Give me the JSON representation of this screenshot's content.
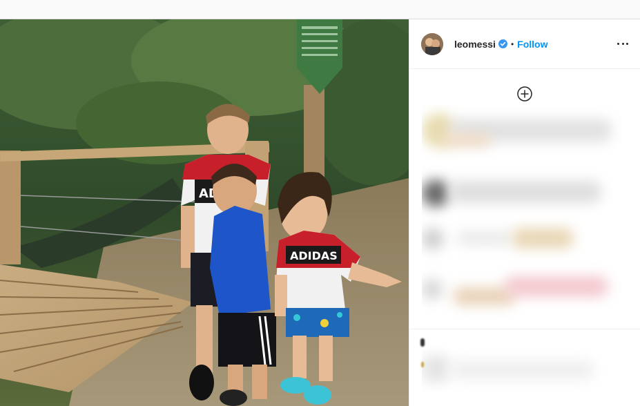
{
  "post": {
    "username": "leomessi",
    "separator": "•",
    "follow_label": "Follow",
    "verified": true
  },
  "photo": {
    "shirt_text_large": "ADIDAS",
    "shirt_text_small": "ADI"
  },
  "icons": {
    "verified": "verified-badge-icon",
    "more": "more-options-icon",
    "add": "add-circle-icon"
  },
  "colors": {
    "follow": "#0095f6",
    "verified": "#3897f0",
    "text": "#262626"
  }
}
